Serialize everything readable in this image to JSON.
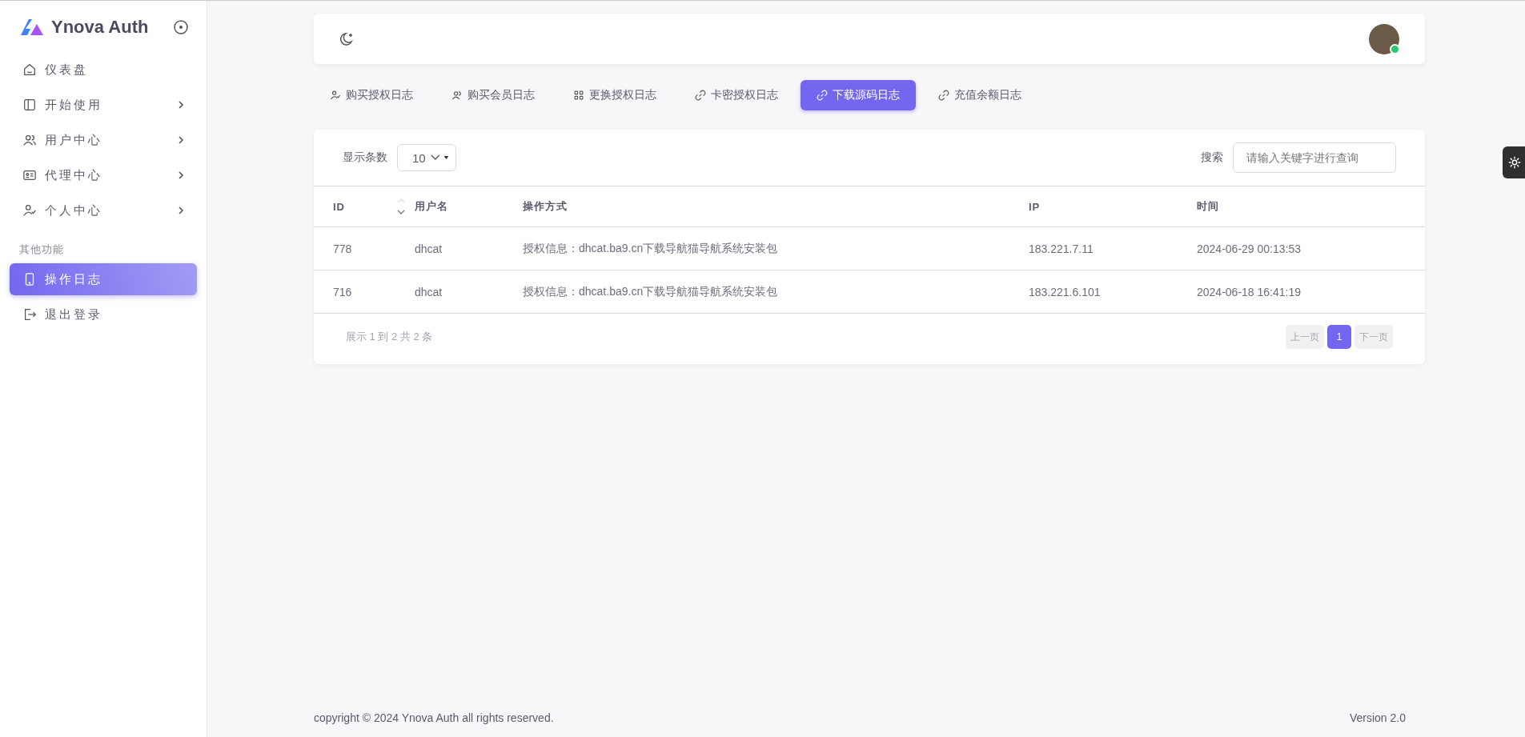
{
  "sidebar": {
    "brand": "Ynova Auth",
    "items": [
      {
        "kind": "home",
        "label": "仪表盘",
        "expandable": false,
        "selected": false
      },
      {
        "kind": "panel",
        "label": "开始使用",
        "expandable": true,
        "selected": false
      },
      {
        "kind": "users",
        "label": "用户中心",
        "expandable": true,
        "selected": false
      },
      {
        "kind": "idcard",
        "label": "代理中心",
        "expandable": true,
        "selected": false
      },
      {
        "kind": "usercheck",
        "label": "个人中心",
        "expandable": true,
        "selected": false
      }
    ],
    "section_title": "其他功能",
    "items_2": [
      {
        "kind": "phone",
        "label": "操作日志",
        "expandable": false,
        "selected": true
      },
      {
        "kind": "logout",
        "label": "退出登录",
        "expandable": false,
        "selected": false
      }
    ]
  },
  "navbar": {
    "avatar_online": true
  },
  "tabs": [
    {
      "kind": "usercheck",
      "label": "购买授权日志",
      "selected": false
    },
    {
      "kind": "users",
      "label": "购买会员日志",
      "selected": false
    },
    {
      "kind": "grid",
      "label": "更换授权日志",
      "selected": false
    },
    {
      "kind": "link",
      "label": "卡密授权日志",
      "selected": false
    },
    {
      "kind": "link",
      "label": "下载源码日志",
      "selected": true
    },
    {
      "kind": "link",
      "label": "充值余额日志",
      "selected": false
    }
  ],
  "table_card": {
    "page_size_label": "显示条数",
    "page_size": "10",
    "search_label": "搜索",
    "search_placeholder": "请输入关键字进行查询",
    "columns": [
      "ID",
      "用户名",
      "操作方式",
      "IP",
      "时间"
    ],
    "rows": [
      [
        "778",
        "dhcat",
        "授权信息：dhcat.ba9.cn下载导航猫导航系统安装包",
        "183.221.7.11",
        "2024-06-29 00:13:53"
      ],
      [
        "716",
        "dhcat",
        "授权信息：dhcat.ba9.cn下载导航猫导航系统安装包",
        "183.221.6.101",
        "2024-06-18 16:41:19"
      ]
    ],
    "summary": "展示 1 到 2 共 2 条",
    "pagination": {
      "prev": "上一页",
      "pages": [
        {
          "label": "1",
          "selected": true
        }
      ],
      "next": "下一页"
    }
  },
  "footer": {
    "copyright": "copyright © 2024 Ynova Auth all rights reserved.",
    "version": "Version 2.0"
  }
}
